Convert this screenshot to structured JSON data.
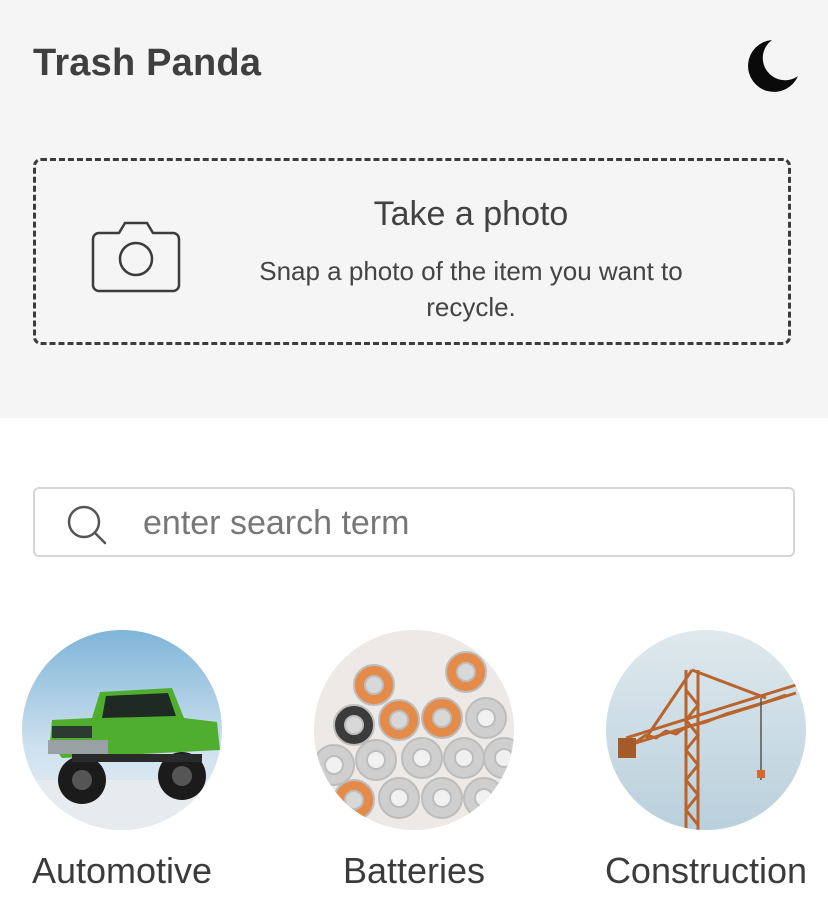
{
  "header": {
    "title": "Trash Panda",
    "theme_toggle_icon": "moon-icon"
  },
  "photo_card": {
    "icon": "camera-icon",
    "title": "Take a photo",
    "description": "Snap a photo of the item you want to recycle."
  },
  "search": {
    "icon": "search-icon",
    "placeholder": "enter search term",
    "value": ""
  },
  "categories": [
    {
      "label": "Automotive",
      "image": "green lifted pickup truck"
    },
    {
      "label": "Batteries",
      "image": "pile of batteries"
    },
    {
      "label": "Construction",
      "image": "construction crane against sky"
    }
  ],
  "colors": {
    "header_bg": "#f4f5f4",
    "text": "#3f3f3f",
    "border": "#d6d6d6"
  }
}
